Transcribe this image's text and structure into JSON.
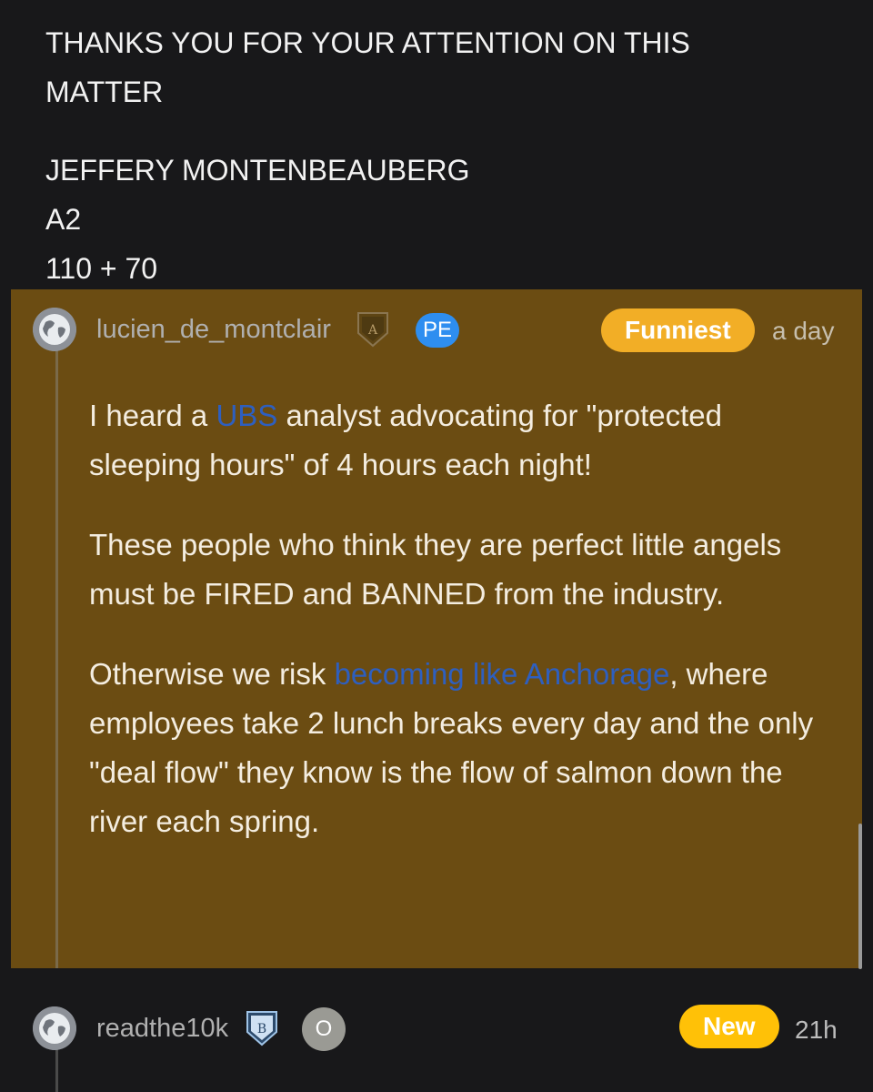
{
  "post_tail": {
    "lines_para1": [
      "THANKS YOU FOR YOUR ATTENTION ON THIS",
      "MATTER"
    ],
    "lines_para2": [
      "JEFFERY MONTENBEAUBERG",
      "A2",
      "110 + 70"
    ]
  },
  "comments": [
    {
      "username": "lucien_de_montclair",
      "rank_letter": "A",
      "industry_tag": "PE",
      "flair": "Funniest",
      "timestamp": "a day",
      "body": {
        "p1_before": "I heard a ",
        "p1_link": "UBS",
        "p1_after": " analyst advocating for \"protected sleeping hours\" of 4 hours each night!",
        "p2": "These people who think they are perfect little angels must be FIRED and BANNED from the industry.",
        "p3_before": "Otherwise we risk ",
        "p3_link": "becoming like Anchorage",
        "p3_after": ", where employees take 2 lunch breaks every day and the only \"deal flow\" they know is the flow of salmon down the river each spring."
      }
    },
    {
      "username": "readthe10k",
      "rank_letter": "B",
      "industry_tag": "O",
      "flair": "New",
      "timestamp": "21h"
    }
  ],
  "colors": {
    "highlight_bg": "#6b4c12",
    "funniest_pill": "#f2ae26",
    "new_pill": "#ffc107",
    "pe_badge": "#2e8ef0",
    "link": "#2e5fbf"
  }
}
